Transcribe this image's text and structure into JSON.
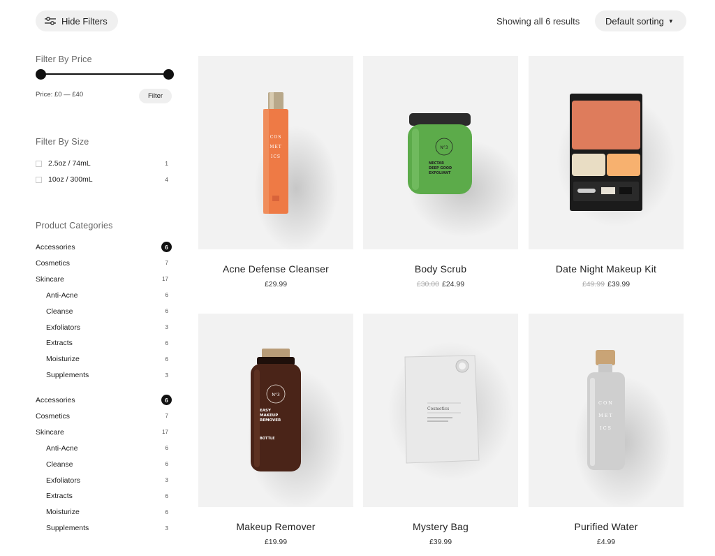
{
  "toolbar": {
    "hide_filters_label": "Hide Filters",
    "results_text": "Showing all 6 results",
    "sort_label": "Default sorting",
    "sort_caret": "▼"
  },
  "filters": {
    "price": {
      "title": "Filter By Price",
      "label": "Price: £0 — £40",
      "button": "Filter",
      "range_min_fraction": 0,
      "range_max_fraction": 1
    },
    "size": {
      "title": "Filter By Size",
      "items": [
        {
          "name": "2.5oz / 74mL",
          "count": "1"
        },
        {
          "name": "10oz / 300mL",
          "count": "4"
        }
      ]
    },
    "categories": {
      "title": "Product Categories",
      "groups": [
        {
          "items": [
            {
              "name": "Accessories",
              "count": "6",
              "badge": true
            },
            {
              "name": "Cosmetics",
              "count": "7"
            },
            {
              "name": "Skincare",
              "count": "17"
            },
            {
              "name": "Anti-Acne",
              "count": "6",
              "sub": true
            },
            {
              "name": "Cleanse",
              "count": "6",
              "sub": true
            },
            {
              "name": "Exfoliators",
              "count": "3",
              "sub": true
            },
            {
              "name": "Extracts",
              "count": "6",
              "sub": true
            },
            {
              "name": "Moisturize",
              "count": "6",
              "sub": true
            },
            {
              "name": "Supplements",
              "count": "3",
              "sub": true
            }
          ]
        },
        {
          "items": [
            {
              "name": "Accessories",
              "count": "6",
              "badge": true
            },
            {
              "name": "Cosmetics",
              "count": "7"
            },
            {
              "name": "Skincare",
              "count": "17"
            },
            {
              "name": "Anti-Acne",
              "count": "6",
              "sub": true
            },
            {
              "name": "Cleanse",
              "count": "6",
              "sub": true
            },
            {
              "name": "Exfoliators",
              "count": "3",
              "sub": true
            },
            {
              "name": "Extracts",
              "count": "6",
              "sub": true
            },
            {
              "name": "Moisturize",
              "count": "6",
              "sub": true
            },
            {
              "name": "Supplements",
              "count": "3",
              "sub": true
            }
          ]
        }
      ]
    }
  },
  "products": [
    {
      "name": "Acne Defense Cleanser",
      "price": "£29.99",
      "old_price": "",
      "image": "orange-bottle",
      "image_text": [
        "COS",
        "MET",
        "ICS"
      ]
    },
    {
      "name": "Body Scrub",
      "price": "£24.99",
      "old_price": "£30.00",
      "image": "green-jar",
      "image_text": [
        "N°3",
        "NECTAR",
        "DEEP GOOD",
        "EXFOLIANT"
      ]
    },
    {
      "name": "Date Night Makeup Kit",
      "price": "£39.99",
      "old_price": "£49.99",
      "image": "makeup-palette",
      "image_text": []
    },
    {
      "name": "Makeup Remover",
      "price": "£19.99",
      "old_price": "",
      "image": "brown-bottle",
      "image_text": [
        "N°3",
        "EASY",
        "MAKEUP",
        "REMOVER",
        "BOTTLE"
      ]
    },
    {
      "name": "Mystery Bag",
      "price": "£39.99",
      "old_price": "",
      "image": "pouch",
      "image_text": [
        "Cosmetics"
      ]
    },
    {
      "name": "Purified Water",
      "price": "£4.99",
      "old_price": "",
      "image": "glass-bottle",
      "image_text": [
        "CON",
        "MET",
        "ICS"
      ]
    }
  ],
  "colors": {
    "accent": "#111111",
    "card_bg": "#f2f2f2",
    "orange": "#ee7a45",
    "green": "#5cab4a",
    "brown": "#4a2418",
    "palette_top": "#de7c5c",
    "palette_left": "#e9ddc4",
    "palette_right": "#f7b16f"
  }
}
